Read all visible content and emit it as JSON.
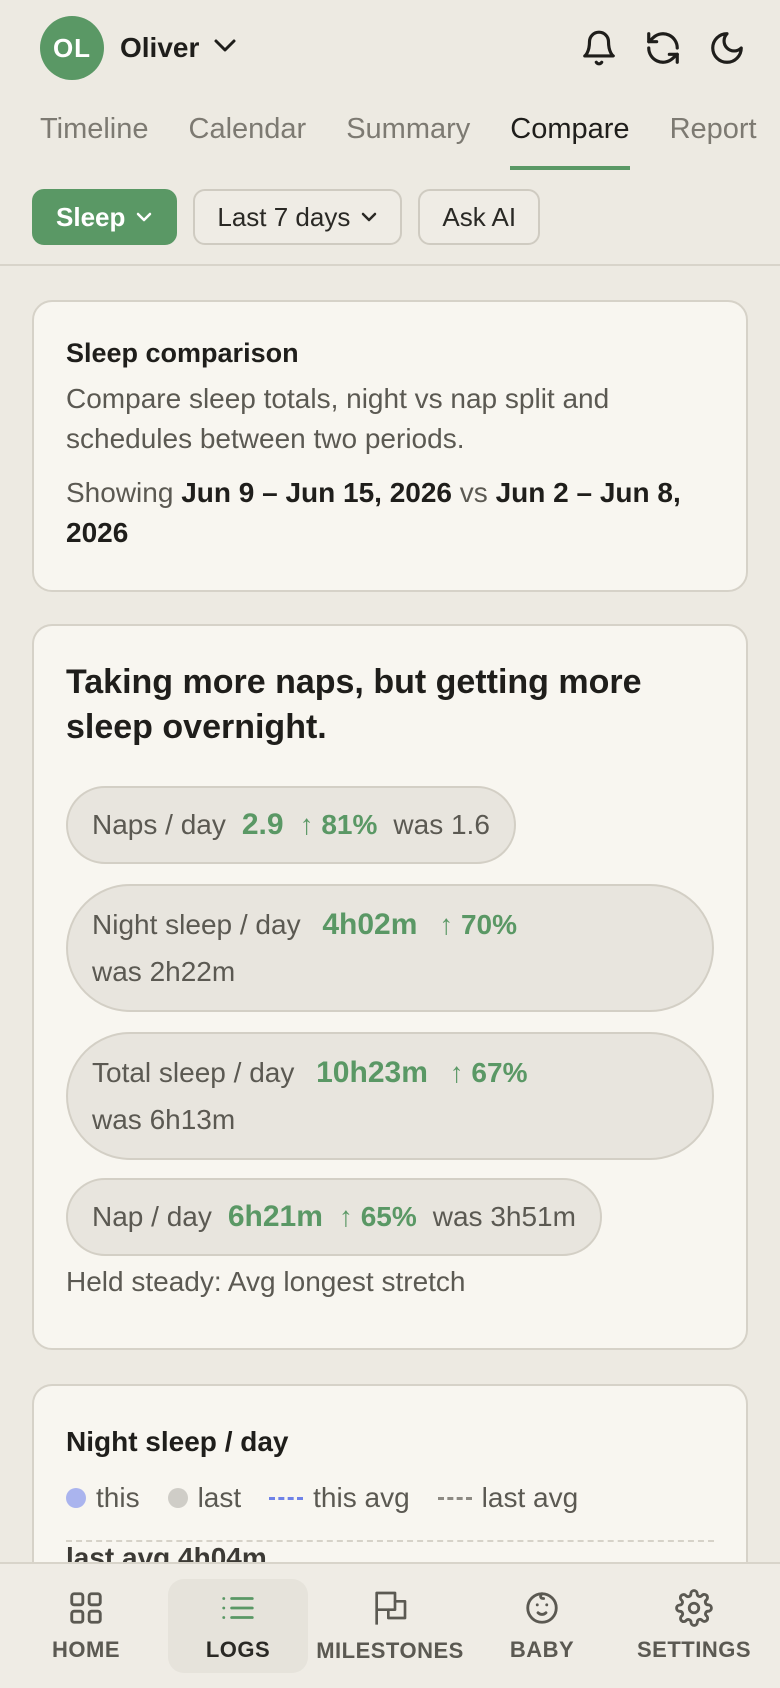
{
  "header": {
    "avatar_initials": "OL",
    "user_name": "Oliver",
    "icons": [
      "bell-icon",
      "refresh-icon",
      "moon-icon"
    ]
  },
  "tabs": [
    {
      "label": "Timeline",
      "active": false
    },
    {
      "label": "Calendar",
      "active": false
    },
    {
      "label": "Summary",
      "active": false
    },
    {
      "label": "Compare",
      "active": true
    },
    {
      "label": "Report",
      "active": false
    }
  ],
  "filters": {
    "metric": "Sleep",
    "range": "Last 7 days",
    "ask_ai": "Ask AI"
  },
  "comparison_card": {
    "title": "Sleep comparison",
    "description": "Compare sleep totals, night vs nap split and schedules between two periods.",
    "showing_label": "Showing",
    "current_range": "Jun 9 – Jun 15, 2026",
    "vs_label": "vs",
    "previous_range": "Jun 2 – Jun 8, 2026"
  },
  "insight_card": {
    "headline": "Taking more naps, but getting more sleep overnight.",
    "metrics": [
      {
        "label": "Naps / day",
        "value": "2.9",
        "change": "↑ 81%",
        "was": "was 1.6"
      },
      {
        "label": "Night sleep / day",
        "value": "4h02m",
        "change": "↑ 70%",
        "was": "was 2h22m"
      },
      {
        "label": "Total sleep / day",
        "value": "10h23m",
        "change": "↑ 67%",
        "was": "was 6h13m"
      },
      {
        "label": "Nap / day",
        "value": "6h21m",
        "change": "↑ 65%",
        "was": "was 3h51m"
      }
    ],
    "steady": "Held steady: Avg longest stretch"
  },
  "night_card": {
    "title": "Night sleep / day",
    "legend": {
      "this": "this",
      "last": "last",
      "this_avg": "this avg",
      "last_avg": "last avg"
    },
    "partial_label": "last avg 4h04m",
    "colors": {
      "this": "#aab4ee",
      "last": "#cfcdc7",
      "this_avg": "#6f82e8",
      "last_avg": "#8d8a83"
    }
  },
  "bottom_nav": [
    {
      "label": "HOME",
      "icon": "grid-icon",
      "active": false
    },
    {
      "label": "LOGS",
      "icon": "list-icon",
      "active": true
    },
    {
      "label": "MILESTONES",
      "icon": "flag-icon",
      "active": false
    },
    {
      "label": "BABY",
      "icon": "baby-face-icon",
      "active": false
    },
    {
      "label": "SETTINGS",
      "icon": "gear-icon",
      "active": false
    }
  ]
}
